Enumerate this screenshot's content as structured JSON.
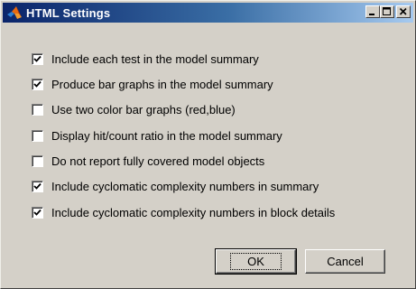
{
  "window": {
    "title": "HTML Settings",
    "title_icon": "matlab-logo-icon"
  },
  "options": [
    {
      "label": "Include each test in the model summary",
      "checked": true
    },
    {
      "label": "Produce bar graphs in the model summary",
      "checked": true
    },
    {
      "label": "Use two color bar graphs (red,blue)",
      "checked": false
    },
    {
      "label": "Display hit/count ratio in the model summary",
      "checked": false
    },
    {
      "label": "Do not report fully covered model objects",
      "checked": false
    },
    {
      "label": "Include cyclomatic complexity numbers in summary",
      "checked": true
    },
    {
      "label": "Include cyclomatic complexity numbers in block details",
      "checked": true
    }
  ],
  "buttons": {
    "ok_label": "OK",
    "cancel_label": "Cancel"
  }
}
